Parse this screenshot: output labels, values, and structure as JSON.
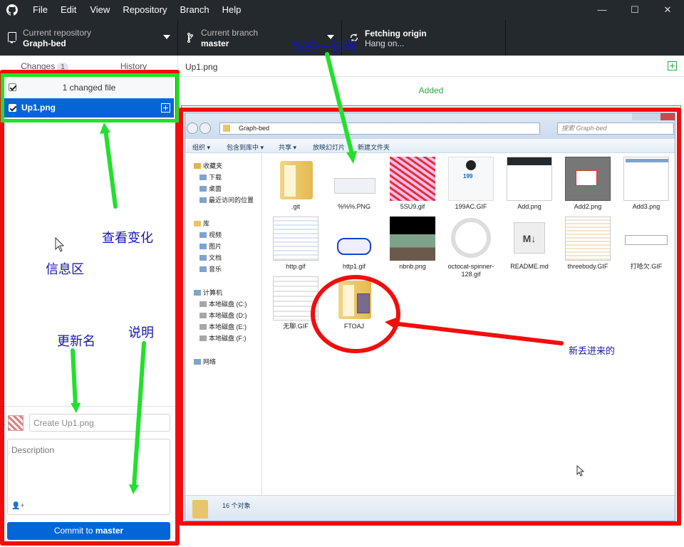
{
  "menu": [
    "File",
    "Edit",
    "View",
    "Repository",
    "Branch",
    "Help"
  ],
  "window_controls": [
    "—",
    "☐",
    "✕"
  ],
  "toolbar": {
    "repo_label": "Current repository",
    "repo_value": "Graph-bed",
    "branch_label": "Current branch",
    "branch_value": "master",
    "fetch_label": "Fetching origin",
    "fetch_value": "Hang on..."
  },
  "sidebar": {
    "tab_changes": "Changes",
    "tab_changes_count": "1",
    "tab_history": "History",
    "changed_header": "1 changed file",
    "file_name": "Up1.png"
  },
  "commit": {
    "summary_placeholder": "Create Up1.png",
    "description_placeholder": "Description",
    "coauthor_icon": "add-coauthor-icon",
    "button_prefix": "Commit to ",
    "button_branch": "master"
  },
  "diff": {
    "file_name": "Up1.png",
    "status": "Added"
  },
  "explorer": {
    "address": "Graph-bed",
    "search": "搜索 Graph-bed",
    "commands": [
      "组织 ▾",
      "包含到库中 ▾",
      "共享 ▾",
      "放映幻灯片",
      "新建文件夹"
    ],
    "nav": {
      "favorites": "收藏夹",
      "downloads": "下载",
      "desktop": "桌面",
      "recent": "最近访问的位置",
      "libraries": "库",
      "videos": "视频",
      "pictures": "图片",
      "documents": "文档",
      "music": "音乐",
      "computer": "计算机",
      "drive_c": "本地磁盘 (C:)",
      "drive_d": "本地磁盘 (D:)",
      "drive_e": "本地磁盘 (E:)",
      "drive_f": "本地磁盘 (F:)",
      "network": "网络"
    },
    "files": [
      ".git",
      "%%%.PNG",
      "5SU9.gif",
      "199AC.GIF",
      "Add.png",
      "Add2.png",
      "Add3.png",
      "http.gif",
      "http1.gif",
      "nbnb.png",
      "octocat-spinner-128.gif",
      "README.md",
      "threebody.GIF",
      "打哈欠.GIF",
      "无聊.GIF",
      "FTOAJ"
    ],
    "status": "16 个对象",
    "readme_glyph": "M↓",
    "badge_199": "199"
  },
  "annotations": {
    "new_image": "新的一张图",
    "view_changes": "查看变化",
    "info_area": "信息区",
    "update_name": "更新名",
    "explain": "说明",
    "newly_added": "新丢进来的"
  },
  "colors": {
    "titlebar": "#24292e",
    "accent_blue": "#0366d6",
    "added_green": "#28a745",
    "annotation_red": "#f20d0d",
    "annotation_green": "#22e02c",
    "annotation_text": "#1616b3"
  }
}
